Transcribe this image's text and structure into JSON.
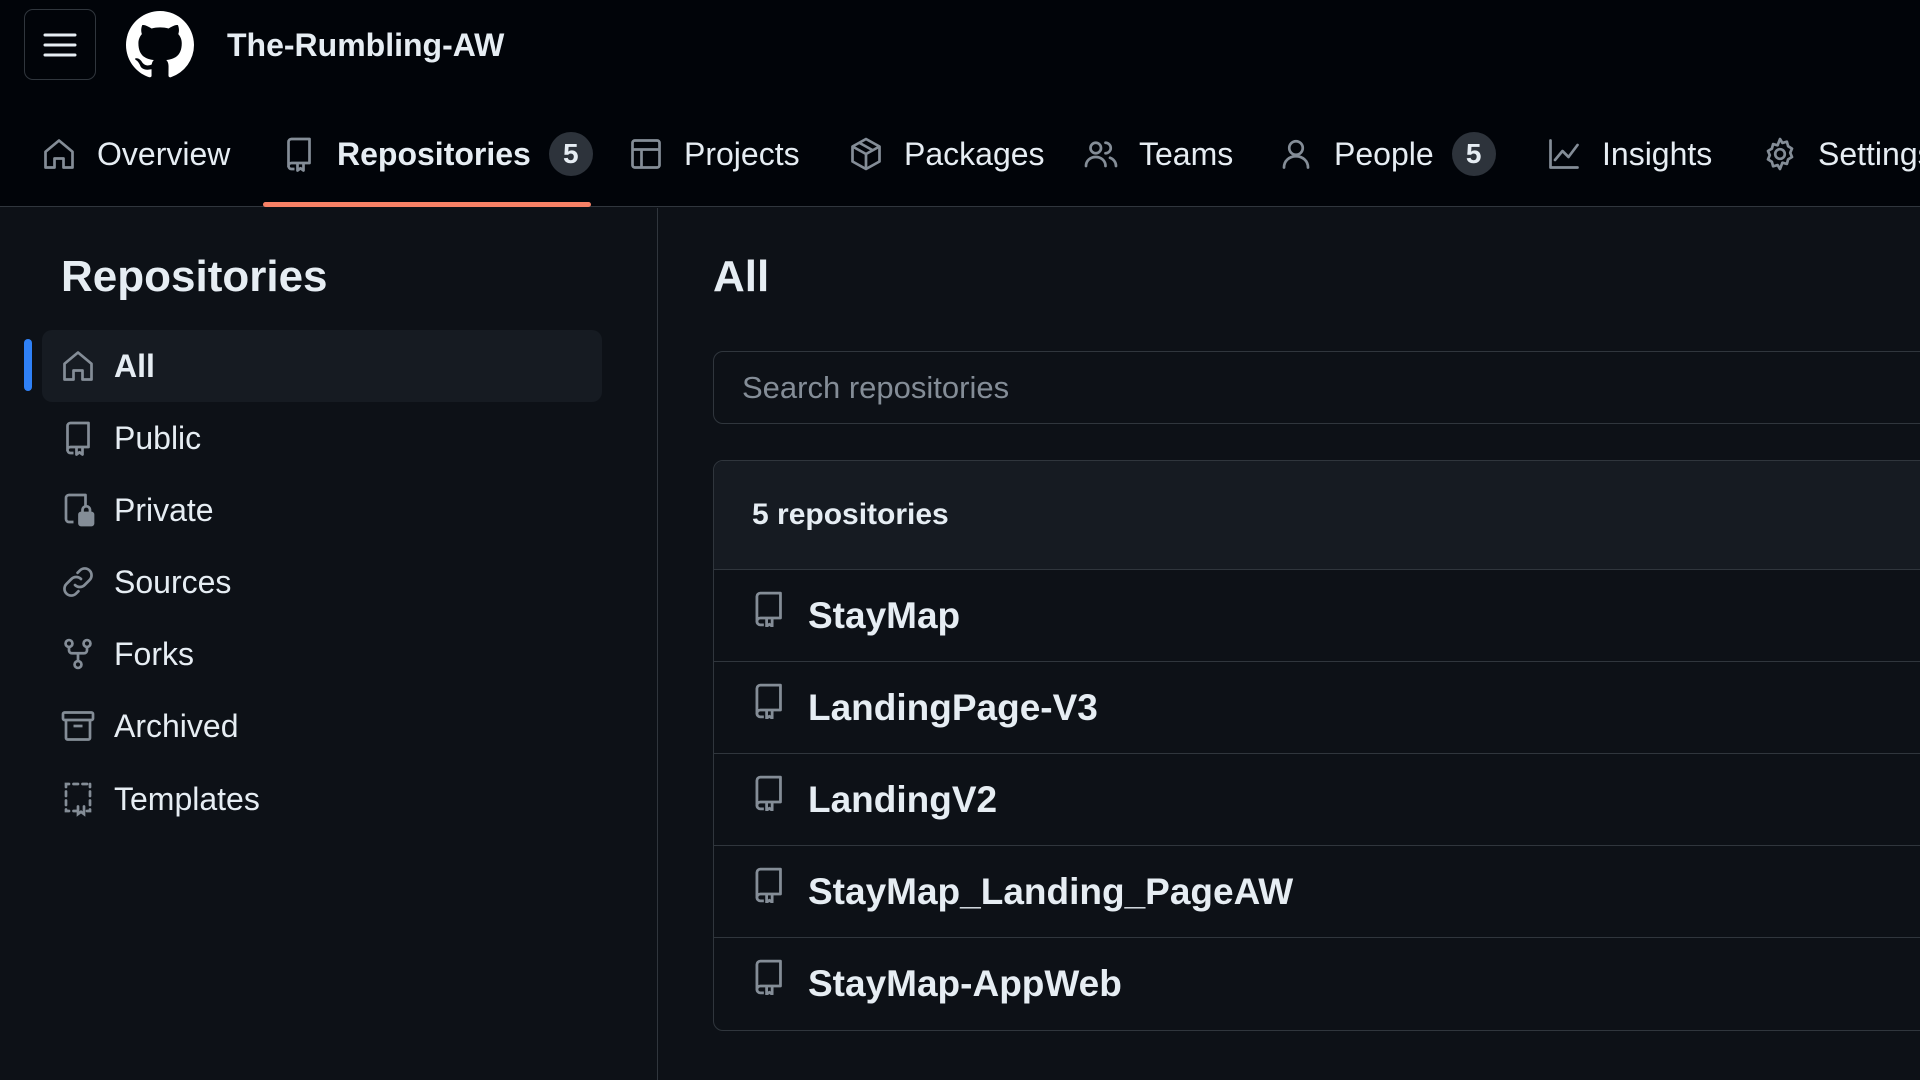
{
  "header": {
    "org_name": "The-Rumbling-AW",
    "tabs": [
      {
        "label": "Overview",
        "icon": "home-icon"
      },
      {
        "label": "Repositories",
        "icon": "repo-icon",
        "count": "5",
        "selected": true
      },
      {
        "label": "Projects",
        "icon": "table-icon"
      },
      {
        "label": "Packages",
        "icon": "package-icon"
      },
      {
        "label": "Teams",
        "icon": "people-icon"
      },
      {
        "label": "People",
        "icon": "person-icon",
        "count": "5"
      },
      {
        "label": "Insights",
        "icon": "graph-icon"
      },
      {
        "label": "Settings",
        "icon": "gear-icon"
      }
    ]
  },
  "sidebar": {
    "title": "Repositories",
    "items": [
      {
        "label": "All",
        "icon": "home-icon",
        "active": true
      },
      {
        "label": "Public",
        "icon": "repo-icon"
      },
      {
        "label": "Private",
        "icon": "lock-repo-icon"
      },
      {
        "label": "Sources",
        "icon": "link-icon"
      },
      {
        "label": "Forks",
        "icon": "fork-icon"
      },
      {
        "label": "Archived",
        "icon": "archive-icon"
      },
      {
        "label": "Templates",
        "icon": "template-icon"
      }
    ]
  },
  "main": {
    "title": "All",
    "search_placeholder": "Search repositories",
    "count_label": "5 repositories",
    "repos": [
      {
        "name": "StayMap"
      },
      {
        "name": "LandingPage-V3"
      },
      {
        "name": "LandingV2"
      },
      {
        "name": "StayMap_Landing_PageAW"
      },
      {
        "name": "StayMap-AppWeb"
      }
    ]
  },
  "colors": {
    "background": "#0d1117",
    "header_bg": "#010409",
    "border": "#30363d",
    "text": "#e6edf3",
    "muted": "#848d97",
    "tab_underline": "#f78166",
    "active_indicator": "#2f81f7"
  }
}
